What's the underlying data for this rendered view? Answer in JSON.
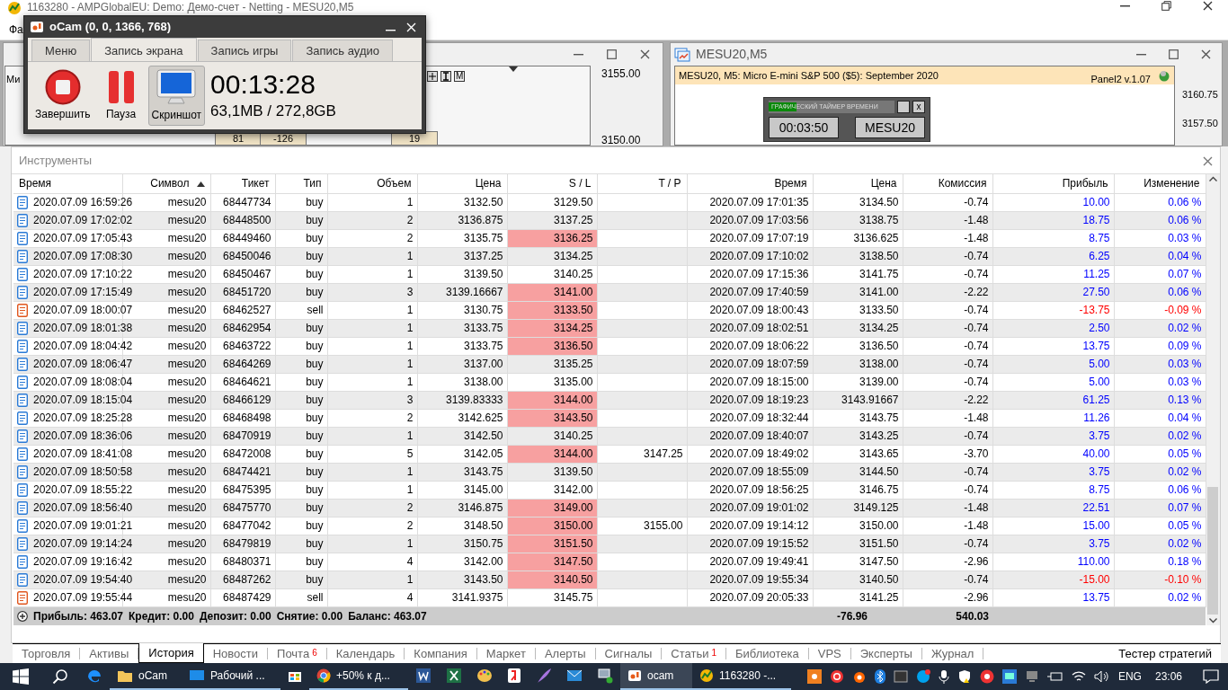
{
  "app": {
    "title": "1163280 - AMPGlobalEU: Demo: Демо-счет - Netting - MESU20,M5",
    "menu": [
      "Фа"
    ]
  },
  "left_chart": {
    "label": "Ми",
    "toolbar": [
      "M"
    ],
    "prices": [
      "3155.00",
      "3150.00"
    ],
    "boxes": [
      "81",
      "-126",
      "19"
    ]
  },
  "right_chart": {
    "title": "MESU20,M5",
    "info": "MESU20, M5:  Micro E-mini S&P 500 ($5): September 2020",
    "panel": "Panel2 v.1.07",
    "prices": [
      "3160.75",
      "3157.50"
    ],
    "timer": {
      "caption": "ГРАФИЧЕСКИЙ ТАЙМЕР ВРЕМЕНИ",
      "level": 0.22,
      "close": "x",
      "time": "00:03:50",
      "symbol": "MESU20"
    }
  },
  "ocam": {
    "title": "oCam (0, 0, 1366, 768)",
    "tabs": [
      {
        "label": "Меню",
        "selected": false
      },
      {
        "label": "Запись экрана",
        "selected": true
      },
      {
        "label": "Запись игры",
        "selected": false
      },
      {
        "label": "Запись аудио",
        "selected": false
      }
    ],
    "buttons": [
      {
        "kind": "stop",
        "label": "Завершить",
        "pressed": false
      },
      {
        "kind": "pause",
        "label": "Пауза",
        "pressed": false
      },
      {
        "kind": "screenshot",
        "label": "Скриншот",
        "pressed": true
      }
    ],
    "elapsed": "00:13:28",
    "size": "63,1MB / 272,8GB"
  },
  "toolbox": {
    "title": "Инструменты",
    "columns": [
      {
        "label": "Время",
        "sorted": false
      },
      {
        "label": "Символ",
        "sorted": true
      },
      {
        "label": "Тикет",
        "sorted": false
      },
      {
        "label": "Тип",
        "sorted": false
      },
      {
        "label": "Объем",
        "sorted": false
      },
      {
        "label": "Цена",
        "sorted": false
      },
      {
        "label": "S / L",
        "sorted": false
      },
      {
        "label": "T / P",
        "sorted": false
      },
      {
        "label": "Время",
        "sorted": false
      },
      {
        "label": "Цена",
        "sorted": false
      },
      {
        "label": "Комиссия",
        "sorted": false
      },
      {
        "label": "Прибыль",
        "sorted": false
      },
      {
        "label": "Изменение",
        "sorted": false
      }
    ],
    "rows": [
      {
        "kind": "buy",
        "time": "2020.07.09 16:59:26",
        "symbol": "mesu20",
        "ticket": "68447734",
        "type": "buy",
        "volume": "1",
        "price": "3132.50",
        "sl": "3129.50",
        "sl_hit": false,
        "close_time": "2020.07.09 17:01:35",
        "close_price": "3134.50",
        "commission": "-0.74",
        "profit": "10.00",
        "change": "0.06 %",
        "loss": false
      },
      {
        "kind": "buy",
        "time": "2020.07.09 17:02:02",
        "symbol": "mesu20",
        "ticket": "68448500",
        "type": "buy",
        "volume": "2",
        "price": "3136.875",
        "sl": "3137.25",
        "sl_hit": false,
        "close_time": "2020.07.09 17:03:56",
        "close_price": "3138.75",
        "commission": "-1.48",
        "profit": "18.75",
        "change": "0.06 %",
        "loss": false
      },
      {
        "kind": "buy",
        "time": "2020.07.09 17:05:43",
        "symbol": "mesu20",
        "ticket": "68449460",
        "type": "buy",
        "volume": "2",
        "price": "3135.75",
        "sl": "3136.25",
        "sl_hit": true,
        "close_time": "2020.07.09 17:07:19",
        "close_price": "3136.625",
        "commission": "-1.48",
        "profit": "8.75",
        "change": "0.03 %",
        "loss": false
      },
      {
        "kind": "buy",
        "time": "2020.07.09 17:08:30",
        "symbol": "mesu20",
        "ticket": "68450046",
        "type": "buy",
        "volume": "1",
        "price": "3137.25",
        "sl": "3134.25",
        "sl_hit": false,
        "close_time": "2020.07.09 17:10:02",
        "close_price": "3138.50",
        "commission": "-0.74",
        "profit": "6.25",
        "change": "0.04 %",
        "loss": false
      },
      {
        "kind": "buy",
        "time": "2020.07.09 17:10:22",
        "symbol": "mesu20",
        "ticket": "68450467",
        "type": "buy",
        "volume": "1",
        "price": "3139.50",
        "sl": "3140.25",
        "sl_hit": false,
        "close_time": "2020.07.09 17:15:36",
        "close_price": "3141.75",
        "commission": "-0.74",
        "profit": "11.25",
        "change": "0.07 %",
        "loss": false
      },
      {
        "kind": "buy",
        "time": "2020.07.09 17:15:49",
        "symbol": "mesu20",
        "ticket": "68451720",
        "type": "buy",
        "volume": "3",
        "price": "3139.16667",
        "sl": "3141.00",
        "sl_hit": true,
        "close_time": "2020.07.09 17:40:59",
        "close_price": "3141.00",
        "commission": "-2.22",
        "profit": "27.50",
        "change": "0.06 %",
        "loss": false
      },
      {
        "kind": "sell",
        "time": "2020.07.09 18:00:07",
        "symbol": "mesu20",
        "ticket": "68462527",
        "type": "sell",
        "volume": "1",
        "price": "3130.75",
        "sl": "3133.50",
        "sl_hit": true,
        "close_time": "2020.07.09 18:00:43",
        "close_price": "3133.50",
        "commission": "-0.74",
        "profit": "-13.75",
        "change": "-0.09 %",
        "loss": true
      },
      {
        "kind": "buy",
        "time": "2020.07.09 18:01:38",
        "symbol": "mesu20",
        "ticket": "68462954",
        "type": "buy",
        "volume": "1",
        "price": "3133.75",
        "sl": "3134.25",
        "sl_hit": true,
        "close_time": "2020.07.09 18:02:51",
        "close_price": "3134.25",
        "commission": "-0.74",
        "profit": "2.50",
        "change": "0.02 %",
        "loss": false
      },
      {
        "kind": "buy",
        "time": "2020.07.09 18:04:42",
        "symbol": "mesu20",
        "ticket": "68463722",
        "type": "buy",
        "volume": "1",
        "price": "3133.75",
        "sl": "3136.50",
        "sl_hit": true,
        "close_time": "2020.07.09 18:06:22",
        "close_price": "3136.50",
        "commission": "-0.74",
        "profit": "13.75",
        "change": "0.09 %",
        "loss": false
      },
      {
        "kind": "buy",
        "time": "2020.07.09 18:06:47",
        "symbol": "mesu20",
        "ticket": "68464269",
        "type": "buy",
        "volume": "1",
        "price": "3137.00",
        "sl": "3135.25",
        "sl_hit": false,
        "close_time": "2020.07.09 18:07:59",
        "close_price": "3138.00",
        "commission": "-0.74",
        "profit": "5.00",
        "change": "0.03 %",
        "loss": false
      },
      {
        "kind": "buy",
        "time": "2020.07.09 18:08:04",
        "symbol": "mesu20",
        "ticket": "68464621",
        "type": "buy",
        "volume": "1",
        "price": "3138.00",
        "sl": "3135.00",
        "sl_hit": false,
        "close_time": "2020.07.09 18:15:00",
        "close_price": "3139.00",
        "commission": "-0.74",
        "profit": "5.00",
        "change": "0.03 %",
        "loss": false
      },
      {
        "kind": "buy",
        "time": "2020.07.09 18:15:04",
        "symbol": "mesu20",
        "ticket": "68466129",
        "type": "buy",
        "volume": "3",
        "price": "3139.83333",
        "sl": "3144.00",
        "sl_hit": true,
        "close_time": "2020.07.09 18:19:23",
        "close_price": "3143.91667",
        "commission": "-2.22",
        "profit": "61.25",
        "change": "0.13 %",
        "loss": false
      },
      {
        "kind": "buy",
        "time": "2020.07.09 18:25:28",
        "symbol": "mesu20",
        "ticket": "68468498",
        "type": "buy",
        "volume": "2",
        "price": "3142.625",
        "sl": "3143.50",
        "sl_hit": true,
        "close_time": "2020.07.09 18:32:44",
        "close_price": "3143.75",
        "commission": "-1.48",
        "profit": "11.26",
        "change": "0.04 %",
        "loss": false
      },
      {
        "kind": "buy",
        "time": "2020.07.09 18:36:06",
        "symbol": "mesu20",
        "ticket": "68470919",
        "type": "buy",
        "volume": "1",
        "price": "3142.50",
        "sl": "3140.25",
        "sl_hit": false,
        "close_time": "2020.07.09 18:40:07",
        "close_price": "3143.25",
        "commission": "-0.74",
        "profit": "3.75",
        "change": "0.02 %",
        "loss": false
      },
      {
        "kind": "buy",
        "time": "2020.07.09 18:41:08",
        "symbol": "mesu20",
        "ticket": "68472008",
        "type": "buy",
        "volume": "5",
        "price": "3142.05",
        "sl": "3144.00",
        "sl_hit": true,
        "tp": "3147.25",
        "close_time": "2020.07.09 18:49:02",
        "close_price": "3143.65",
        "commission": "-3.70",
        "profit": "40.00",
        "change": "0.05 %",
        "loss": false
      },
      {
        "kind": "buy",
        "time": "2020.07.09 18:50:58",
        "symbol": "mesu20",
        "ticket": "68474421",
        "type": "buy",
        "volume": "1",
        "price": "3143.75",
        "sl": "3139.50",
        "sl_hit": false,
        "close_time": "2020.07.09 18:55:09",
        "close_price": "3144.50",
        "commission": "-0.74",
        "profit": "3.75",
        "change": "0.02 %",
        "loss": false
      },
      {
        "kind": "buy",
        "time": "2020.07.09 18:55:22",
        "symbol": "mesu20",
        "ticket": "68475395",
        "type": "buy",
        "volume": "1",
        "price": "3145.00",
        "sl": "3142.00",
        "sl_hit": false,
        "close_time": "2020.07.09 18:56:25",
        "close_price": "3146.75",
        "commission": "-0.74",
        "profit": "8.75",
        "change": "0.06 %",
        "loss": false
      },
      {
        "kind": "buy",
        "time": "2020.07.09 18:56:40",
        "symbol": "mesu20",
        "ticket": "68475770",
        "type": "buy",
        "volume": "2",
        "price": "3146.875",
        "sl": "3149.00",
        "sl_hit": true,
        "close_time": "2020.07.09 19:01:02",
        "close_price": "3149.125",
        "commission": "-1.48",
        "profit": "22.51",
        "change": "0.07 %",
        "loss": false
      },
      {
        "kind": "buy",
        "time": "2020.07.09 19:01:21",
        "symbol": "mesu20",
        "ticket": "68477042",
        "type": "buy",
        "volume": "2",
        "price": "3148.50",
        "sl": "3150.00",
        "sl_hit": true,
        "tp": "3155.00",
        "close_time": "2020.07.09 19:14:12",
        "close_price": "3150.00",
        "commission": "-1.48",
        "profit": "15.00",
        "change": "0.05 %",
        "loss": false
      },
      {
        "kind": "buy",
        "time": "2020.07.09 19:14:24",
        "symbol": "mesu20",
        "ticket": "68479819",
        "type": "buy",
        "volume": "1",
        "price": "3150.75",
        "sl": "3151.50",
        "sl_hit": true,
        "close_time": "2020.07.09 19:15:52",
        "close_price": "3151.50",
        "commission": "-0.74",
        "profit": "3.75",
        "change": "0.02 %",
        "loss": false
      },
      {
        "kind": "buy",
        "time": "2020.07.09 19:16:42",
        "symbol": "mesu20",
        "ticket": "68480371",
        "type": "buy",
        "volume": "4",
        "price": "3142.00",
        "sl": "3147.50",
        "sl_hit": true,
        "close_time": "2020.07.09 19:49:41",
        "close_price": "3147.50",
        "commission": "-2.96",
        "profit": "110.00",
        "change": "0.18 %",
        "loss": false
      },
      {
        "kind": "buy",
        "time": "2020.07.09 19:54:40",
        "symbol": "mesu20",
        "ticket": "68487262",
        "type": "buy",
        "volume": "1",
        "price": "3143.50",
        "sl": "3140.50",
        "sl_hit": true,
        "close_time": "2020.07.09 19:55:34",
        "close_price": "3140.50",
        "commission": "-0.74",
        "profit": "-15.00",
        "change": "-0.10 %",
        "loss": true
      },
      {
        "kind": "sell",
        "time": "2020.07.09 19:55:44",
        "symbol": "mesu20",
        "ticket": "68487429",
        "type": "sell",
        "volume": "4",
        "price": "3141.9375",
        "sl": "3145.75",
        "sl_hit": false,
        "close_time": "2020.07.09 20:05:33",
        "close_price": "3141.25",
        "commission": "-2.96",
        "profit": "13.75",
        "change": "0.02 %",
        "loss": false
      }
    ],
    "summary": {
      "items": [
        "Прибыль: 463.07",
        "Кредит: 0.00",
        "Депозит: 0.00",
        "Снятие: 0.00",
        "Баланс: 463.07"
      ],
      "commission": "-76.96",
      "profit": "540.03"
    },
    "tabs": [
      {
        "label": "Торговля",
        "selected": false
      },
      {
        "label": "Активы",
        "selected": false
      },
      {
        "label": "История",
        "selected": true
      },
      {
        "label": "Новости",
        "selected": false
      },
      {
        "label": "Почта",
        "selected": false,
        "badge": "6"
      },
      {
        "label": "Календарь",
        "selected": false
      },
      {
        "label": "Компания",
        "selected": false
      },
      {
        "label": "Маркет",
        "selected": false
      },
      {
        "label": "Алерты",
        "selected": false
      },
      {
        "label": "Сигналы",
        "selected": false
      },
      {
        "label": "Статьи",
        "selected": false,
        "badge": "1"
      },
      {
        "label": "Библиотека",
        "selected": false
      },
      {
        "label": "VPS",
        "selected": false
      },
      {
        "label": "Эксперты",
        "selected": false
      },
      {
        "label": "Журнал",
        "selected": false
      }
    ],
    "tester": "Тестер стратегий"
  },
  "taskbar": {
    "items": [
      {
        "kind": "edge",
        "running": false,
        "active": false
      },
      {
        "kind": "folder",
        "label": "oCam",
        "running": true,
        "active": false
      },
      {
        "kind": "remote",
        "label": "Рабочий ...",
        "running": true,
        "active": false
      },
      {
        "kind": "store",
        "running": false,
        "active": false
      },
      {
        "kind": "chrome",
        "label": "+50% к д...",
        "running": true,
        "active": false
      },
      {
        "kind": "word",
        "running": false,
        "active": false
      },
      {
        "kind": "excel",
        "running": false,
        "active": false
      },
      {
        "kind": "paint",
        "running": false,
        "active": false
      },
      {
        "kind": "yandex",
        "running": false,
        "active": false
      },
      {
        "kind": "feather",
        "running": false,
        "active": false
      },
      {
        "kind": "mail",
        "running": false,
        "active": false
      },
      {
        "kind": "network",
        "running": false,
        "active": false
      },
      {
        "kind": "ocam",
        "label": "ocam",
        "running": true,
        "active": true
      },
      {
        "kind": "terminal",
        "label": "1163280 -...",
        "running": true,
        "active": false
      }
    ],
    "language": "ENG",
    "clock": "23:06"
  }
}
